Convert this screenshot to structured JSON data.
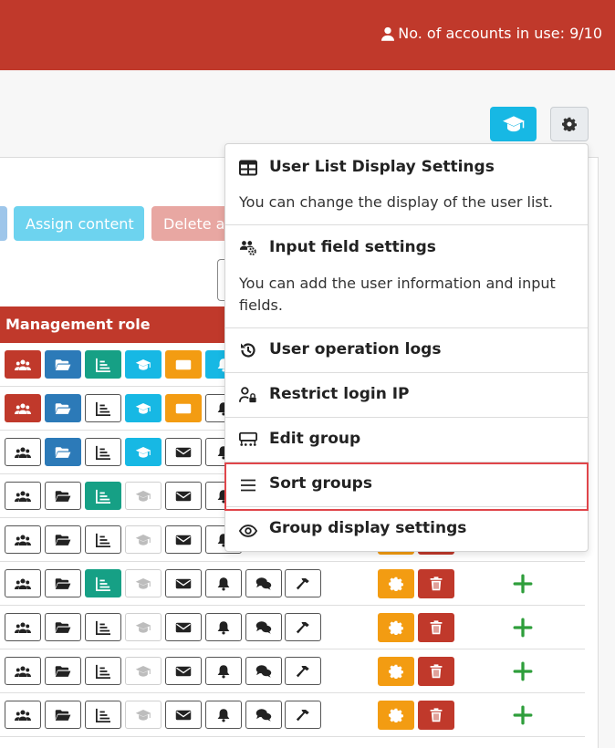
{
  "header": {
    "accounts_text": "No. of accounts in use: 9/10"
  },
  "actions": {
    "assign": "Assign content",
    "delete": "Delete a"
  },
  "table": {
    "header": "Management role"
  },
  "menu": {
    "items": [
      {
        "title": "User List Display Settings",
        "desc": "You can change the display of the user list."
      },
      {
        "title": "Input field settings",
        "desc": "You can add the user information and input fields."
      },
      {
        "title": "User operation logs"
      },
      {
        "title": "Restrict login IP"
      },
      {
        "title": "Edit group"
      },
      {
        "title": "Sort groups"
      },
      {
        "title": "Group display settings"
      }
    ],
    "highlight_color": "#e0454a"
  },
  "colors": {
    "brand": "#c0392b",
    "cyan": "#17b8e4",
    "orange": "#f39c12",
    "green": "#16a085",
    "blue": "#2c7ab8"
  }
}
